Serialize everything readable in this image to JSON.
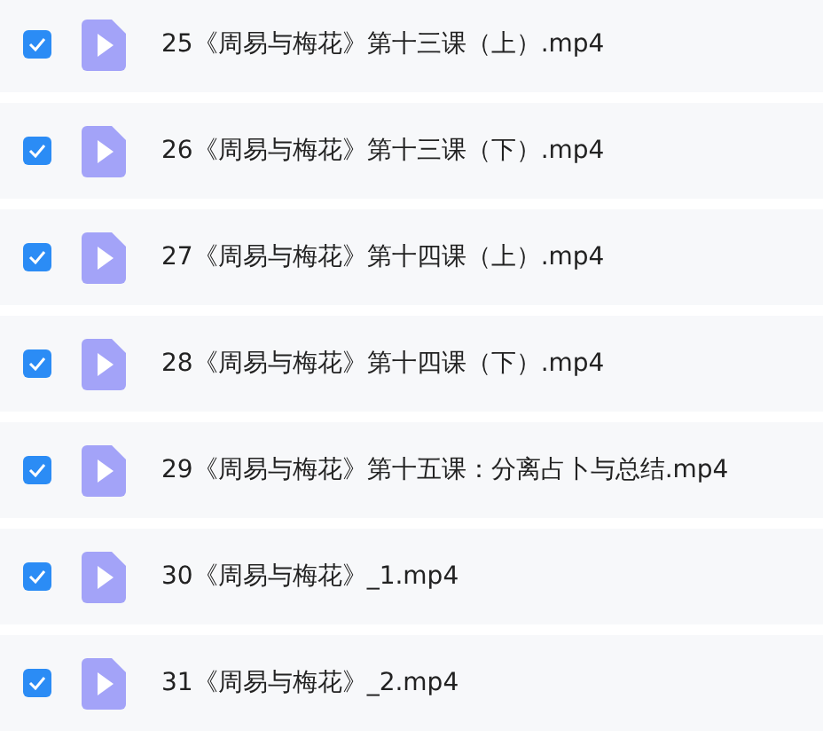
{
  "files": [
    {
      "name": "25《周易与梅花》第十三课（上）.mp4",
      "checked": true
    },
    {
      "name": "26《周易与梅花》第十三课（下）.mp4",
      "checked": true
    },
    {
      "name": "27《周易与梅花》第十四课（上）.mp4",
      "checked": true
    },
    {
      "name": "28《周易与梅花》第十四课（下）.mp4",
      "checked": true
    },
    {
      "name": "29《周易与梅花》第十五课：分离占卜与总结.mp4",
      "checked": true
    },
    {
      "name": "30《周易与梅花》_1.mp4",
      "checked": true
    },
    {
      "name": "31《周易与梅花》_2.mp4",
      "checked": true
    }
  ]
}
